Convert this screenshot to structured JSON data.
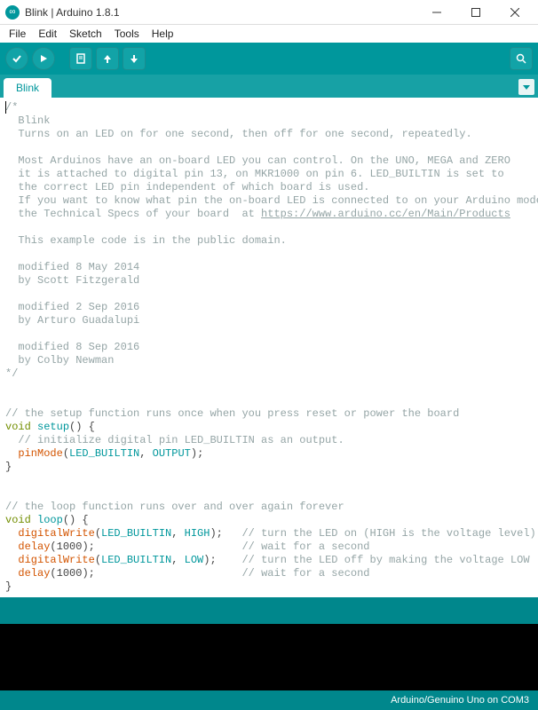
{
  "window": {
    "title": "Blink | Arduino 1.8.1"
  },
  "menu": {
    "file": "File",
    "edit": "Edit",
    "sketch": "Sketch",
    "tools": "Tools",
    "help": "Help"
  },
  "tabs": {
    "active": "Blink"
  },
  "footer": {
    "board": "Arduino/Genuino Uno on COM3"
  },
  "code": {
    "c1": "/*",
    "c2": "  Blink",
    "c3": "  Turns on an LED on for one second, then off for one second, repeatedly.",
    "c4": "  Most Arduinos have an on-board LED you can control. On the UNO, MEGA and ZERO",
    "c5": "  it is attached to digital pin 13, on MKR1000 on pin 6. LED_BUILTIN is set to",
    "c6": "  the correct LED pin independent of which board is used.",
    "c7": "  If you want to know what pin the on-board LED is connected to on your Arduino model, check",
    "c8a": "  the Technical Specs of your board  at ",
    "c8link": "https://www.arduino.cc/en/Main/Products",
    "c9": "  This example code is in the public domain.",
    "c10": "  modified 8 May 2014",
    "c11": "  by Scott Fitzgerald",
    "c12": "  modified 2 Sep 2016",
    "c13": "  by Arturo Guadalupi",
    "c14": "  modified 8 Sep 2016",
    "c15": "  by Colby Newman",
    "c16": "*/",
    "sc1": "// the setup function runs once when you press reset or power the board",
    "kw_void": "void",
    "fn_setup": "setup",
    "paren_open": "() {",
    "sc2": "  // initialize digital pin LED_BUILTIN as an output.",
    "fn_pinmode": "pinMode",
    "paren": "(",
    "const_led": "LED_BUILTIN",
    "comma": ", ",
    "const_output": "OUTPUT",
    "close_stmt": ");",
    "brace_close": "}",
    "sc3": "// the loop function runs over and over again forever",
    "fn_loop": "loop",
    "fn_dw": "digitalWrite",
    "const_high": "HIGH",
    "cmt_on": "// turn the LED on (HIGH is the voltage level)",
    "fn_delay": "delay",
    "num_1000": "1000",
    "cmt_wait": "// wait for a second",
    "const_low": "LOW",
    "cmt_off": "// turn the LED off by making the voltage LOW",
    "indent": "  ",
    "sp3": ");   ",
    "sp4": ");    ",
    "sp_dw": ");                       "
  }
}
